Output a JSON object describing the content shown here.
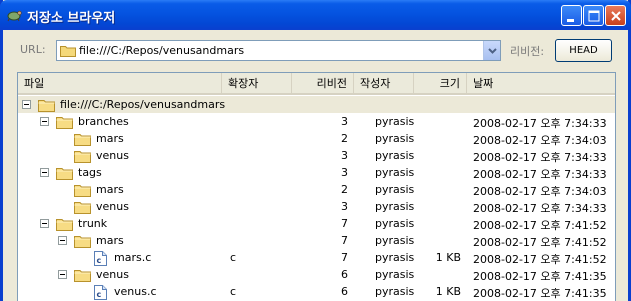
{
  "window": {
    "title": "저장소 브라우저"
  },
  "toolbar": {
    "url_label": "URL:",
    "url_value": "file:///C:/Repos/venusandmars",
    "revision_label": "리비전:",
    "head_button": "HEAD"
  },
  "columns": {
    "file": "파일",
    "ext": "확장자",
    "rev": "리비전",
    "author": "작성자",
    "size": "크기",
    "date": "날짜"
  },
  "rows": [
    {
      "name": "file:///C:/Repos/venusandmars",
      "ext": "",
      "rev": "",
      "author": "",
      "size": "",
      "date": "",
      "type": "folder",
      "level": 0,
      "expanded": true,
      "selected": true
    },
    {
      "name": "branches",
      "ext": "",
      "rev": "3",
      "author": "pyrasis",
      "size": "",
      "date": "2008-02-17 오후 7:34:33",
      "type": "folder",
      "level": 1,
      "expanded": true
    },
    {
      "name": "mars",
      "ext": "",
      "rev": "2",
      "author": "pyrasis",
      "size": "",
      "date": "2008-02-17 오후 7:34:03",
      "type": "folder",
      "level": 2
    },
    {
      "name": "venus",
      "ext": "",
      "rev": "3",
      "author": "pyrasis",
      "size": "",
      "date": "2008-02-17 오후 7:34:33",
      "type": "folder",
      "level": 2
    },
    {
      "name": "tags",
      "ext": "",
      "rev": "3",
      "author": "pyrasis",
      "size": "",
      "date": "2008-02-17 오후 7:34:33",
      "type": "folder",
      "level": 1,
      "expanded": true
    },
    {
      "name": "mars",
      "ext": "",
      "rev": "2",
      "author": "pyrasis",
      "size": "",
      "date": "2008-02-17 오후 7:34:03",
      "type": "folder",
      "level": 2
    },
    {
      "name": "venus",
      "ext": "",
      "rev": "3",
      "author": "pyrasis",
      "size": "",
      "date": "2008-02-17 오후 7:34:33",
      "type": "folder",
      "level": 2
    },
    {
      "name": "trunk",
      "ext": "",
      "rev": "7",
      "author": "pyrasis",
      "size": "",
      "date": "2008-02-17 오후 7:41:52",
      "type": "folder",
      "level": 1,
      "expanded": true
    },
    {
      "name": "mars",
      "ext": "",
      "rev": "7",
      "author": "pyrasis",
      "size": "",
      "date": "2008-02-17 오후 7:41:52",
      "type": "folder",
      "level": 2,
      "expanded": true
    },
    {
      "name": "mars.c",
      "ext": "c",
      "rev": "7",
      "author": "pyrasis",
      "size": "1 KB",
      "date": "2008-02-17 오후 7:41:52",
      "type": "file",
      "level": 3
    },
    {
      "name": "venus",
      "ext": "",
      "rev": "6",
      "author": "pyrasis",
      "size": "",
      "date": "2008-02-17 오후 7:41:35",
      "type": "folder",
      "level": 2,
      "expanded": true
    },
    {
      "name": "venus.c",
      "ext": "c",
      "rev": "6",
      "author": "pyrasis",
      "size": "1 KB",
      "date": "2008-02-17 오후 7:41:35",
      "type": "file",
      "level": 3
    }
  ]
}
